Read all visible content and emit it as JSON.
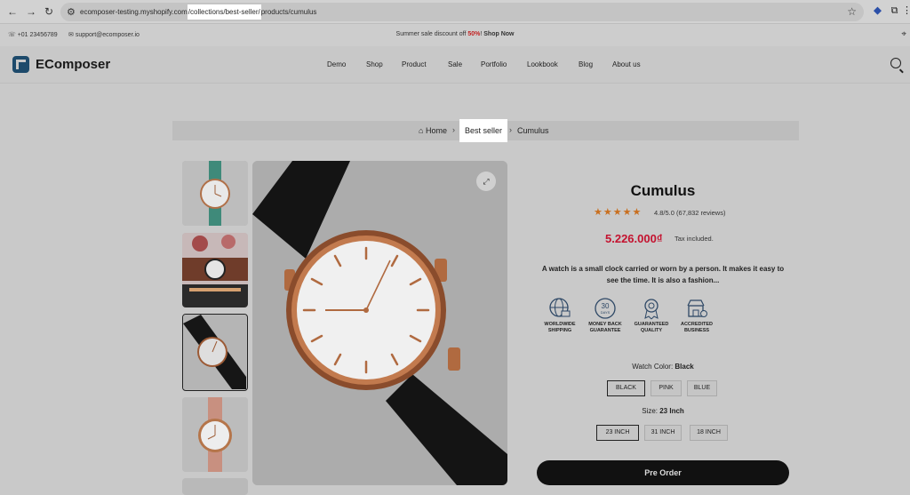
{
  "browser": {
    "url_prefix": "ecomposer-testing.myshopify.com",
    "url_highlight": "/collections/best-seller/",
    "url_suffix": "products/cumulus"
  },
  "topbar": {
    "phone": "+01 23456789",
    "email": "support@ecomposer.io",
    "promo_pre": "Summer sale discount off ",
    "promo_pct": "50%",
    "promo_sep": "! ",
    "promo_link": "Shop Now"
  },
  "header": {
    "logo": "EComposer",
    "menu": [
      "Demo",
      "Shop",
      "Product",
      "Sale",
      "Portfolio",
      "Lookbook",
      "Blog",
      "About us"
    ]
  },
  "breadcrumb": {
    "home": "Home",
    "parent": "Best seller",
    "current": "Cumulus"
  },
  "product": {
    "title": "Cumulus",
    "stars": "★★★★★",
    "rating_text": "4.8/5.0 (67,832 reviews)",
    "price": "5.226.000₫",
    "tax": "Tax included.",
    "description": "A watch is a small clock carried or worn by a person. It makes it easy to see the time. It is also a fashion...",
    "features": [
      {
        "icon": "globe-truck-icon",
        "line1": "WORLDWIDE",
        "line2": "SHIPPING"
      },
      {
        "icon": "money-back-30-days-icon",
        "line1": "MONEY BACK",
        "line2": "GUARANTEE"
      },
      {
        "icon": "quality-medal-icon",
        "line1": "GUARANTEED",
        "line2": "QUALITY"
      },
      {
        "icon": "accredited-store-icon",
        "line1": "ACCREDITED",
        "line2": "BUSINESS"
      }
    ],
    "badge_30": "30",
    "badge_days": "DAYS",
    "color_label": "Watch Color: ",
    "color_value": "Black",
    "colors": [
      "BLACK",
      "PINK",
      "BLUE"
    ],
    "size_label": "Size: ",
    "size_value": "23 Inch",
    "sizes": [
      "23 INCH",
      "31 INCH",
      "18 INCH"
    ],
    "cta": "Pre Order"
  }
}
